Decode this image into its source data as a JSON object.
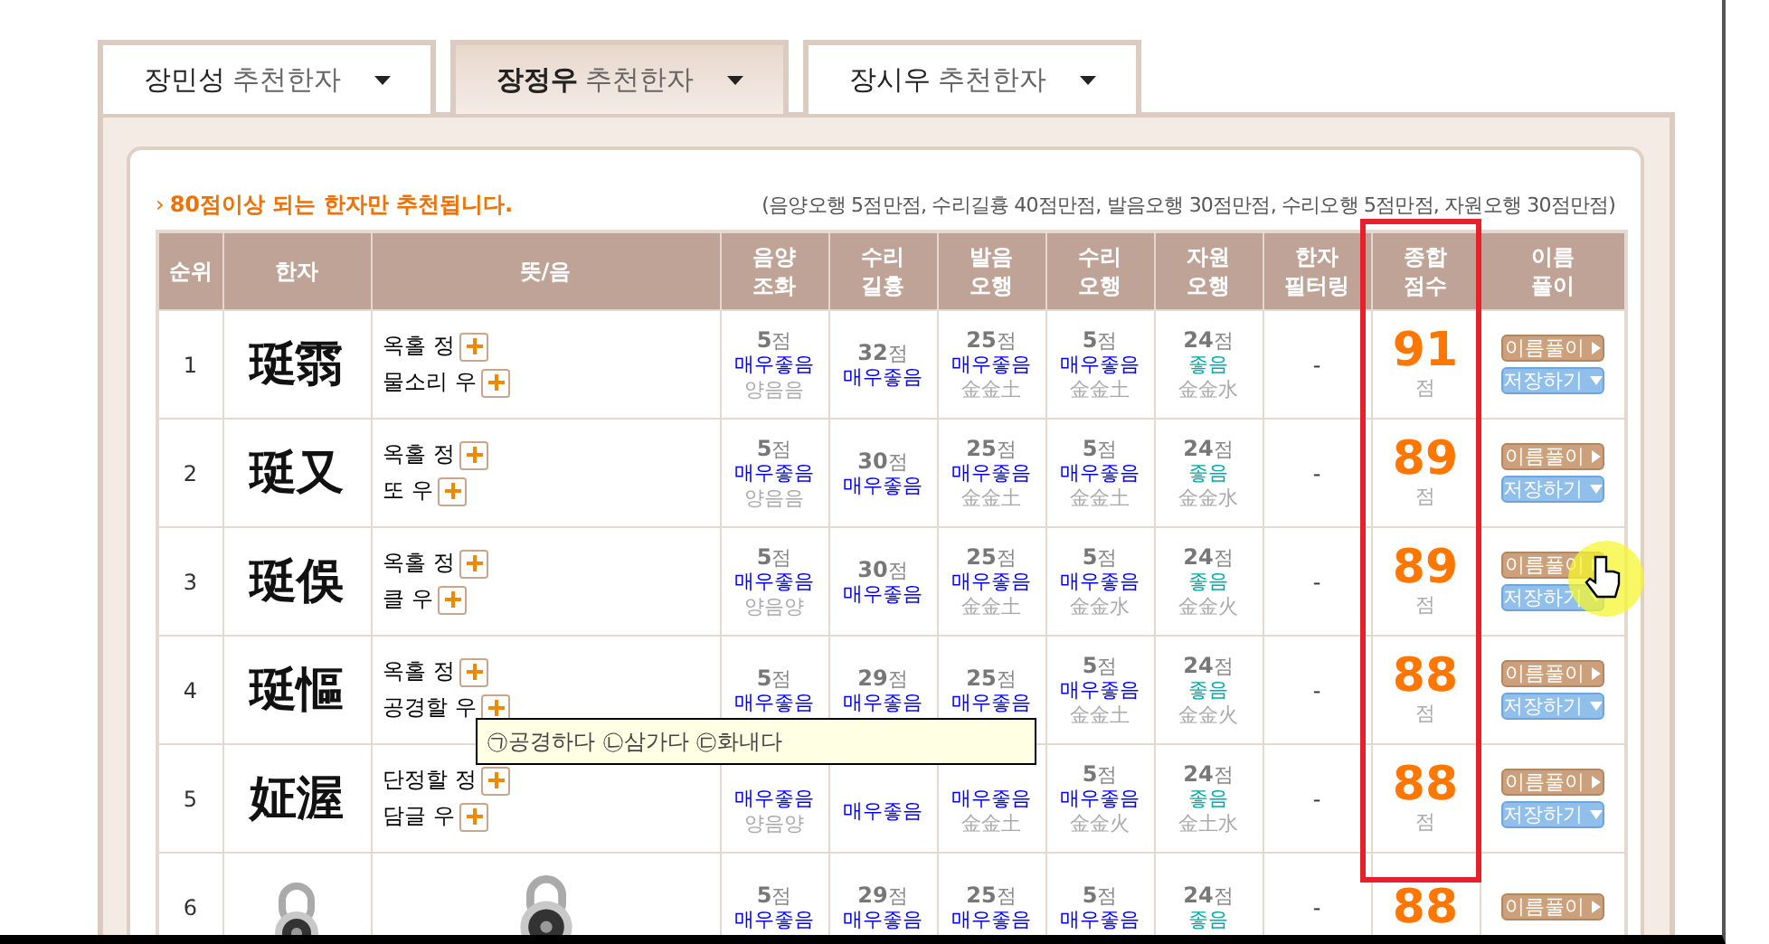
{
  "tabs": [
    {
      "name": "장민성",
      "suffix": "추천한자",
      "selected": false
    },
    {
      "name": "장정우",
      "suffix": "추천한자",
      "selected": true
    },
    {
      "name": "장시우",
      "suffix": "추천한자",
      "selected": false
    }
  ],
  "notice": {
    "marker": "›",
    "text": "80점이상 되는 한자만 추천됩니다.",
    "note": "(음양오행 5점만점, 수리길흉 40점만점, 발음오행 30점만점, 수리오행 5점만점, 자원오행 30점만점)"
  },
  "table": {
    "columns": [
      [
        "순위"
      ],
      [
        "한자"
      ],
      [
        "뜻/음"
      ],
      [
        "음양",
        "조화"
      ],
      [
        "수리",
        "길흉"
      ],
      [
        "발음",
        "오행"
      ],
      [
        "수리",
        "오행"
      ],
      [
        "자원",
        "오행"
      ],
      [
        "한자",
        "필터링"
      ],
      [
        "종합",
        "점수"
      ],
      [
        "이름",
        "풀이"
      ]
    ],
    "rows": [
      {
        "rank": "1",
        "hanja": "珽䨒",
        "meanings": [
          "옥홀 정",
          "물소리 우"
        ],
        "scores": [
          {
            "score": "**5**점",
            "rating": "매우좋음",
            "color": "#0000ee",
            "detail": "양음음"
          },
          {
            "score": "**32**점",
            "rating": "매우좋음",
            "color": "#0000ee"
          },
          {
            "score": "**25**점",
            "rating": "매우좋음",
            "color": "#0000ee",
            "detail": "金金土"
          },
          {
            "score": "**5**점",
            "rating": "매우좋음",
            "color": "#0000ee",
            "detail": "金金土"
          },
          {
            "score": "**24**점",
            "rating": "좋음",
            "color": "#00aaaa",
            "detail": "金金水"
          }
        ],
        "filter": "-",
        "total": "91",
        "unit": "점",
        "buttons": [
          "이름풀이",
          "저장하기"
        ]
      },
      {
        "rank": "2",
        "hanja": "珽又",
        "meanings": [
          "옥홀 정",
          "또 우"
        ],
        "scores": [
          {
            "score": "**5**점",
            "rating": "매우좋음",
            "color": "#0000ee",
            "detail": "양음음"
          },
          {
            "score": "**30**점",
            "rating": "매우좋음",
            "color": "#0000ee"
          },
          {
            "score": "**25**점",
            "rating": "매우좋음",
            "color": "#0000ee",
            "detail": "金金土"
          },
          {
            "score": "**5**점",
            "rating": "매우좋음",
            "color": "#0000ee",
            "detail": "金金土"
          },
          {
            "score": "**24**점",
            "rating": "좋음",
            "color": "#00aaaa",
            "detail": "金金水"
          }
        ],
        "filter": "-",
        "total": "89",
        "unit": "점",
        "buttons": [
          "이름풀이",
          "저장하기"
        ]
      },
      {
        "rank": "3",
        "hanja": "珽俁",
        "meanings": [
          "옥홀 정",
          "클 우"
        ],
        "scores": [
          {
            "score": "**5**점",
            "rating": "매우좋음",
            "color": "#0000ee",
            "detail": "양음양"
          },
          {
            "score": "**30**점",
            "rating": "매우좋음",
            "color": "#0000ee"
          },
          {
            "score": "**25**점",
            "rating": "매우좋음",
            "color": "#0000ee",
            "detail": "金金土"
          },
          {
            "score": "**5**점",
            "rating": "매우좋음",
            "color": "#0000ee",
            "detail": "金金水"
          },
          {
            "score": "**24**점",
            "rating": "좋음",
            "color": "#00aaaa",
            "detail": "金金火"
          }
        ],
        "filter": "-",
        "total": "89",
        "unit": "점",
        "buttons": [
          "이름풀이",
          "저장하기"
        ]
      },
      {
        "rank": "4",
        "hanja": "珽慪",
        "meanings": [
          "옥홀 정",
          "공경할 우"
        ],
        "scores": [
          {
            "score": "**5**점",
            "rating": "매우좋음",
            "color": "#0000ee"
          },
          {
            "score": "**29**점",
            "rating": "매우좋음",
            "color": "#0000ee"
          },
          {
            "score": "**25**점",
            "rating": "매우좋음",
            "color": "#0000ee"
          },
          {
            "score": "**5**점",
            "rating": "매우좋음",
            "color": "#0000ee",
            "detail": "金金土"
          },
          {
            "score": "**24**점",
            "rating": "좋음",
            "color": "#00aaaa",
            "detail": "金金火"
          }
        ],
        "filter": "-",
        "total": "88",
        "unit": "점",
        "buttons": [
          "이름풀이",
          "저장하기"
        ]
      },
      {
        "rank": "5",
        "hanja": "姃渥",
        "meanings": [
          "단정할 정",
          "담글 우"
        ],
        "scores": [
          {
            "rating": "매우좋음",
            "color": "#0000ee",
            "detail": "양음양"
          },
          {
            "rating": "매우좋음",
            "color": "#0000ee"
          },
          {
            "rating": "매우좋음",
            "color": "#0000ee",
            "detail": "金金土"
          },
          {
            "score": "**5**점",
            "rating": "매우좋음",
            "color": "#0000ee",
            "detail": "金金火"
          },
          {
            "score": "**24**점",
            "rating": "좋음",
            "color": "#00aaaa",
            "detail": "金土水"
          }
        ],
        "filter": "-",
        "total": "88",
        "unit": "점",
        "buttons": [
          "이름풀이",
          "저장하기"
        ]
      },
      {
        "rank": "6",
        "kind": "picture",
        "scores": [
          {
            "score": "**5**점",
            "rating": "매우좋음",
            "color": "#0000ee"
          },
          {
            "score": "**29**점",
            "rating": "매우좋음",
            "color": "#0000ee"
          },
          {
            "score": "**25**점",
            "rating": "매우좋음",
            "color": "#0000ee"
          },
          {
            "score": "**5**점",
            "rating": "매우좋음",
            "color": "#0000ee"
          },
          {
            "score": "**24**점",
            "rating": "좋음",
            "color": "#00aaaa"
          }
        ],
        "filter": "-",
        "total": "88",
        "buttons": [
          "이름풀이"
        ]
      }
    ]
  },
  "tooltip": {
    "text": "㉠공경하다 ㉡삼가다 ㉢화내다"
  }
}
